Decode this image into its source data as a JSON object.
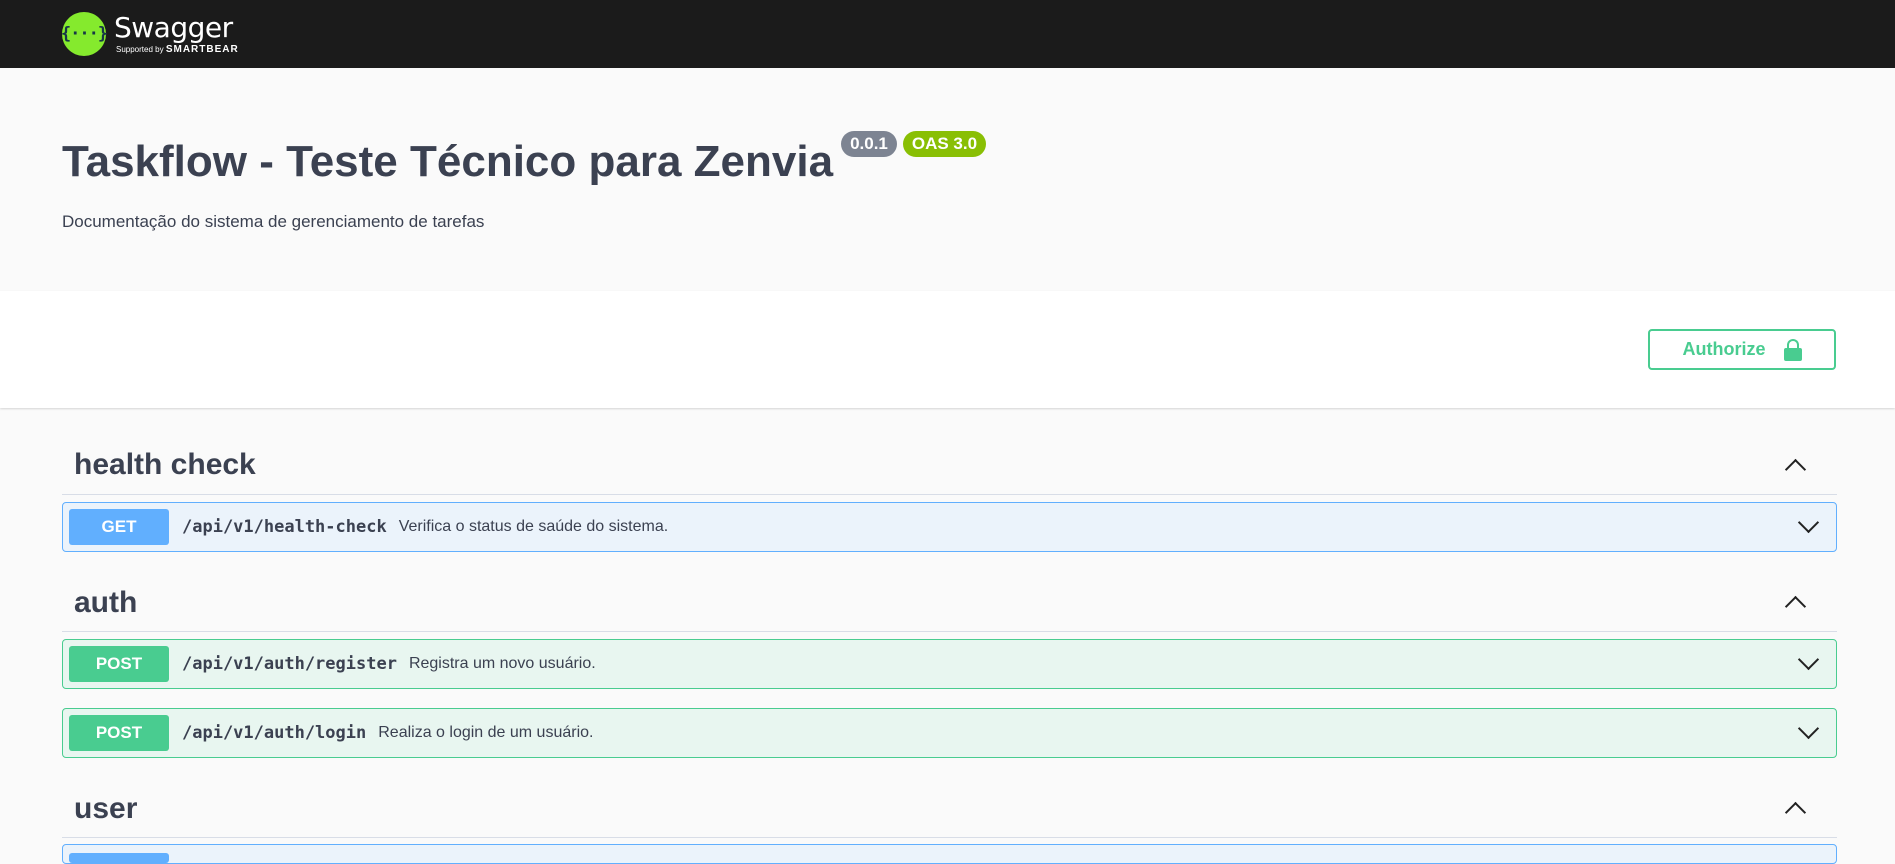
{
  "header": {
    "logo_mark": "{···}",
    "logo_name": "Swagger",
    "logo_supported": "Supported by",
    "logo_brand": "SMARTBEAR"
  },
  "info": {
    "title": "Taskflow - Teste Técnico para Zenvia",
    "version": "0.0.1",
    "oas": "OAS 3.0",
    "description": "Documentação do sistema de gerenciamento de tarefas"
  },
  "auth": {
    "authorize_label": "Authorize"
  },
  "colors": {
    "get": "#61affe",
    "post": "#49cc90",
    "topbar": "#1b1b1b",
    "logo": "#85ea2d"
  },
  "tags": [
    {
      "name": "health check",
      "operations": [
        {
          "method": "GET",
          "path": "/api/v1/health-check",
          "summary": "Verifica o status de saúde do sistema."
        }
      ]
    },
    {
      "name": "auth",
      "operations": [
        {
          "method": "POST",
          "path": "/api/v1/auth/register",
          "summary": "Registra um novo usuário."
        },
        {
          "method": "POST",
          "path": "/api/v1/auth/login",
          "summary": "Realiza o login de um usuário."
        }
      ]
    },
    {
      "name": "user",
      "operations": [
        {
          "method": "",
          "path": "",
          "summary": ""
        }
      ]
    }
  ]
}
